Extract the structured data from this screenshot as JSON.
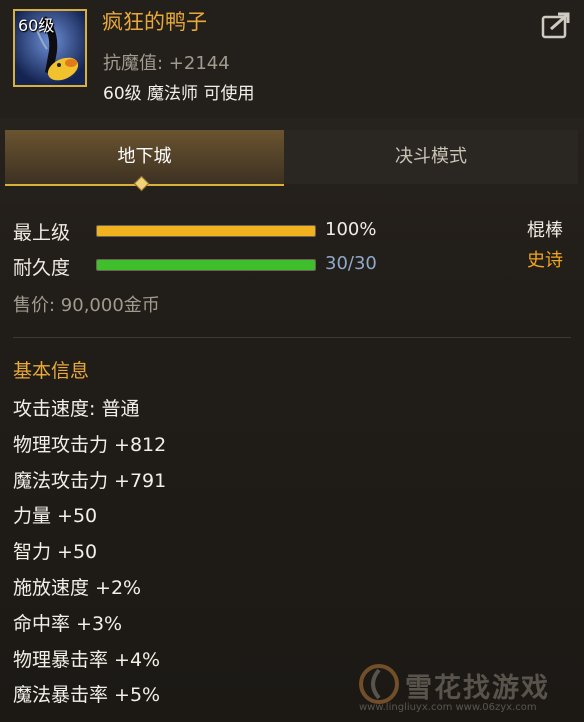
{
  "item": {
    "level_badge": "60级",
    "name": "疯狂的鸭子",
    "anti_magic": "抗魔值: +2144",
    "requirement": "60级 魔法师 可使用"
  },
  "tabs": [
    {
      "label": "地下城",
      "active": true
    },
    {
      "label": "决斗模式",
      "active": false
    }
  ],
  "stats": {
    "upgrade": {
      "label": "最上级",
      "value_text": "100%",
      "fill": 1.0,
      "color": "#f2b21f"
    },
    "durability": {
      "label": "耐久度",
      "value_text": "30/30",
      "fill": 1.0,
      "color": "#3fbf2b"
    },
    "weapon_type": "棍棒",
    "rarity": "史诗",
    "price": "售价: 90,000金币"
  },
  "basic_info": {
    "title": "基本信息",
    "attributes": [
      "攻击速度: 普通",
      "物理攻击力 +812",
      "魔法攻击力 +791",
      "力量 +50",
      "智力 +50",
      "施放速度 +2%",
      "命中率 +3%",
      "物理暴击率 +4%",
      "魔法暴击率 +5%"
    ]
  },
  "watermark": {
    "brand": "雪花找游戏",
    "url": "www.lingliuyx.com  www.06zyx.com"
  },
  "colors": {
    "accent_gold": "#e8a93a",
    "epic_orange": "#f2a51f",
    "durability_value": "#8fa9c9"
  }
}
